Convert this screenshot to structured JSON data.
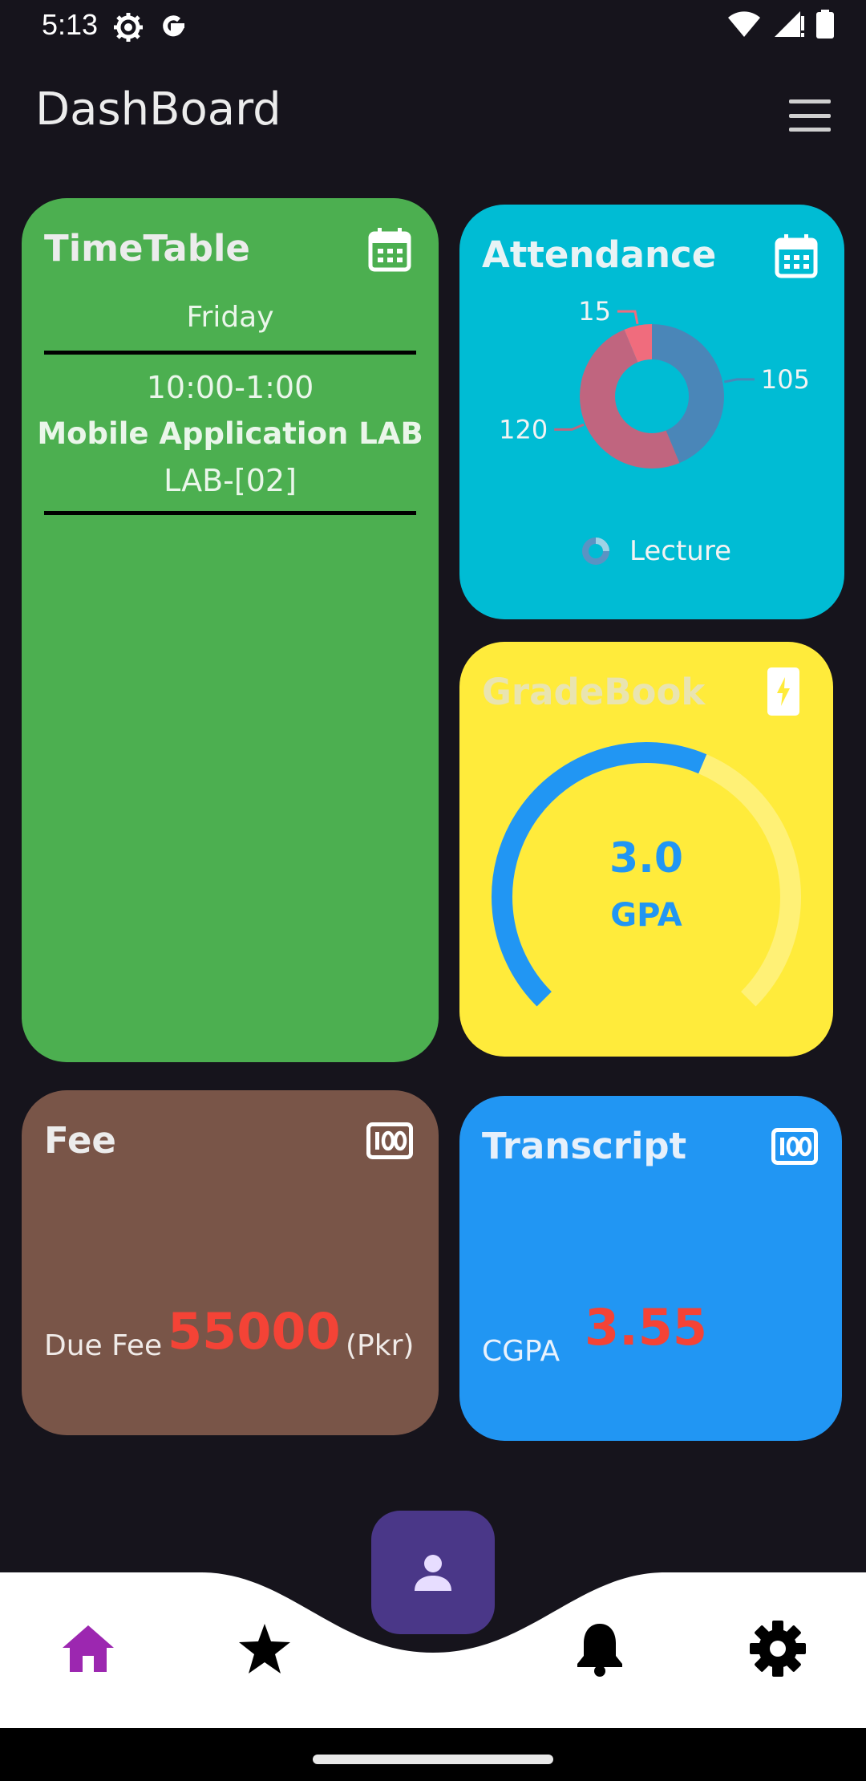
{
  "status_bar": {
    "time": "5:13"
  },
  "app_bar": {
    "title": "DashBoard"
  },
  "timetable": {
    "title": "TimeTable",
    "day": "Friday",
    "entries": [
      {
        "time": "10:00-1:00",
        "subject": "Mobile Application LAB",
        "room": "LAB-[02]"
      }
    ]
  },
  "attendance": {
    "title": "Attendance",
    "chart_data": {
      "type": "pie",
      "categories": [
        "105",
        "120",
        "15"
      ],
      "values": [
        105,
        120,
        15
      ],
      "colors": [
        "#4a86b8",
        "#c0657f",
        "#f06c7d"
      ],
      "legend": [
        "Lecture"
      ]
    }
  },
  "gradebook": {
    "title": "GradeBook",
    "gpa_value": "3.0",
    "gpa_label": "GPA",
    "gauge_fraction": 0.75
  },
  "fee": {
    "title": "Fee",
    "due_label": "Due Fee",
    "amount": "55000",
    "currency": "(Pkr)"
  },
  "transcript": {
    "title": "Transcript",
    "cgpa_label": "CGPA",
    "cgpa_value": "3.55"
  },
  "bottom_nav": {
    "items": [
      "home-icon",
      "star-icon",
      "bell-icon",
      "settings-icon"
    ],
    "active": "home-icon",
    "fab_icon": "person-icon",
    "active_color": "#9c27b0"
  }
}
